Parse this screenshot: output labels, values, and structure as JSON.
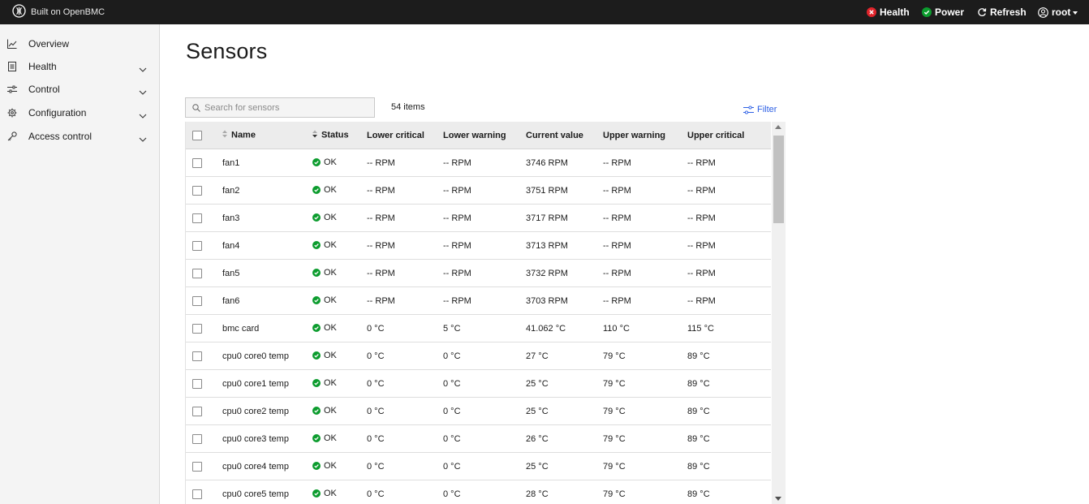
{
  "brand": {
    "text": "Built on OpenBMC"
  },
  "topbar": {
    "health": "Health",
    "power": "Power",
    "refresh": "Refresh",
    "user": "root",
    "health_status_color": "#e0242b",
    "power_status_color": "#0c9c2e"
  },
  "sidebar": {
    "items": [
      {
        "label": "Overview",
        "icon": "chart-line-icon",
        "expandable": false
      },
      {
        "label": "Health",
        "icon": "document-icon",
        "expandable": true
      },
      {
        "label": "Control",
        "icon": "sliders-icon",
        "expandable": true
      },
      {
        "label": "Configuration",
        "icon": "gear-icon",
        "expandable": true
      },
      {
        "label": "Access control",
        "icon": "key-icon",
        "expandable": true
      }
    ]
  },
  "main": {
    "title": "Sensors",
    "search_placeholder": "Search for sensors",
    "items_count": "54 items",
    "filter_label": "Filter"
  },
  "table": {
    "columns": [
      "Name",
      "Status",
      "Lower critical",
      "Lower warning",
      "Current value",
      "Upper warning",
      "Upper critical"
    ],
    "status_ok_color": "#0c9c2e",
    "rows": [
      {
        "name": "fan1",
        "status": "OK",
        "lower_critical": "-- RPM",
        "lower_warning": "-- RPM",
        "current": "3746 RPM",
        "upper_warning": "-- RPM",
        "upper_critical": "-- RPM"
      },
      {
        "name": "fan2",
        "status": "OK",
        "lower_critical": "-- RPM",
        "lower_warning": "-- RPM",
        "current": "3751 RPM",
        "upper_warning": "-- RPM",
        "upper_critical": "-- RPM"
      },
      {
        "name": "fan3",
        "status": "OK",
        "lower_critical": "-- RPM",
        "lower_warning": "-- RPM",
        "current": "3717 RPM",
        "upper_warning": "-- RPM",
        "upper_critical": "-- RPM"
      },
      {
        "name": "fan4",
        "status": "OK",
        "lower_critical": "-- RPM",
        "lower_warning": "-- RPM",
        "current": "3713 RPM",
        "upper_warning": "-- RPM",
        "upper_critical": "-- RPM"
      },
      {
        "name": "fan5",
        "status": "OK",
        "lower_critical": "-- RPM",
        "lower_warning": "-- RPM",
        "current": "3732 RPM",
        "upper_warning": "-- RPM",
        "upper_critical": "-- RPM"
      },
      {
        "name": "fan6",
        "status": "OK",
        "lower_critical": "-- RPM",
        "lower_warning": "-- RPM",
        "current": "3703 RPM",
        "upper_warning": "-- RPM",
        "upper_critical": "-- RPM"
      },
      {
        "name": "bmc card",
        "status": "OK",
        "lower_critical": "0 °C",
        "lower_warning": "5 °C",
        "current": "41.062 °C",
        "upper_warning": "110 °C",
        "upper_critical": "115 °C"
      },
      {
        "name": "cpu0 core0 temp",
        "status": "OK",
        "lower_critical": "0 °C",
        "lower_warning": "0 °C",
        "current": "27 °C",
        "upper_warning": "79 °C",
        "upper_critical": "89 °C"
      },
      {
        "name": "cpu0 core1 temp",
        "status": "OK",
        "lower_critical": "0 °C",
        "lower_warning": "0 °C",
        "current": "25 °C",
        "upper_warning": "79 °C",
        "upper_critical": "89 °C"
      },
      {
        "name": "cpu0 core2 temp",
        "status": "OK",
        "lower_critical": "0 °C",
        "lower_warning": "0 °C",
        "current": "25 °C",
        "upper_warning": "79 °C",
        "upper_critical": "89 °C"
      },
      {
        "name": "cpu0 core3 temp",
        "status": "OK",
        "lower_critical": "0 °C",
        "lower_warning": "0 °C",
        "current": "26 °C",
        "upper_warning": "79 °C",
        "upper_critical": "89 °C"
      },
      {
        "name": "cpu0 core4 temp",
        "status": "OK",
        "lower_critical": "0 °C",
        "lower_warning": "0 °C",
        "current": "25 °C",
        "upper_warning": "79 °C",
        "upper_critical": "89 °C"
      },
      {
        "name": "cpu0 core5 temp",
        "status": "OK",
        "lower_critical": "0 °C",
        "lower_warning": "0 °C",
        "current": "28 °C",
        "upper_warning": "79 °C",
        "upper_critical": "89 °C"
      }
    ]
  }
}
